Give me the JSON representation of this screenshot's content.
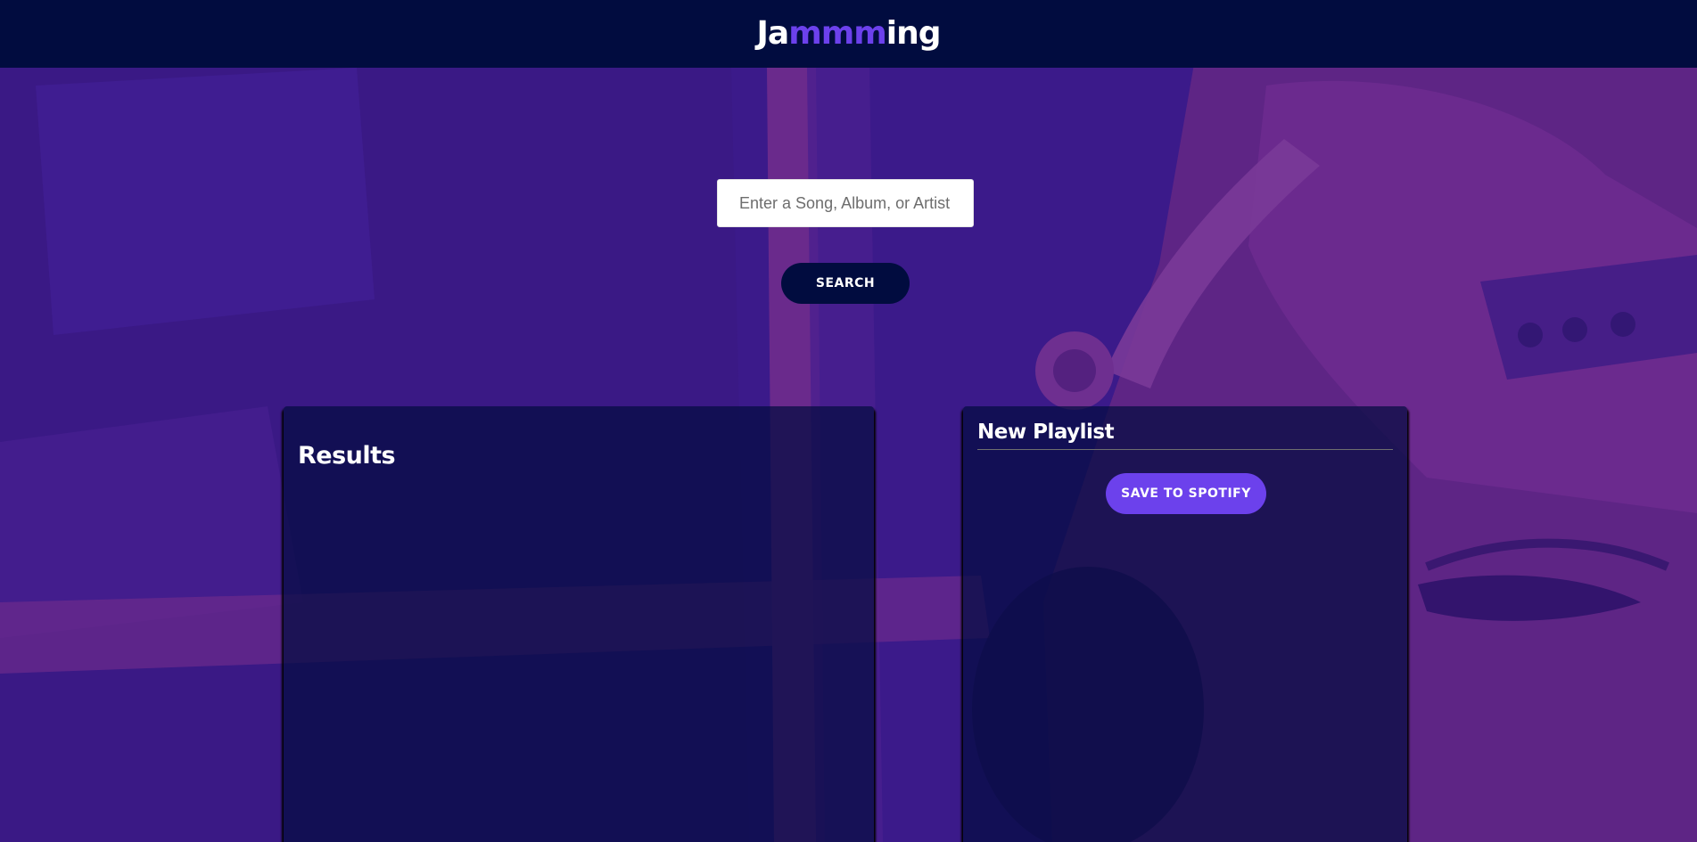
{
  "header": {
    "logo_prefix": "Ja",
    "logo_highlight": "mmm",
    "logo_suffix": "ing"
  },
  "colors": {
    "header_bg": "#010c3f",
    "accent": "#6c41ec",
    "panel_bg": "#010c3f",
    "background_purple": "#3b1a8a",
    "background_magenta": "#6a2a8c"
  },
  "search": {
    "placeholder": "Enter a Song, Album, or Artist",
    "value": "",
    "button_label": "SEARCH"
  },
  "results": {
    "title": "Results",
    "tracks": []
  },
  "playlist": {
    "name": "New Playlist",
    "save_label": "SAVE TO SPOTIFY",
    "tracks": []
  }
}
